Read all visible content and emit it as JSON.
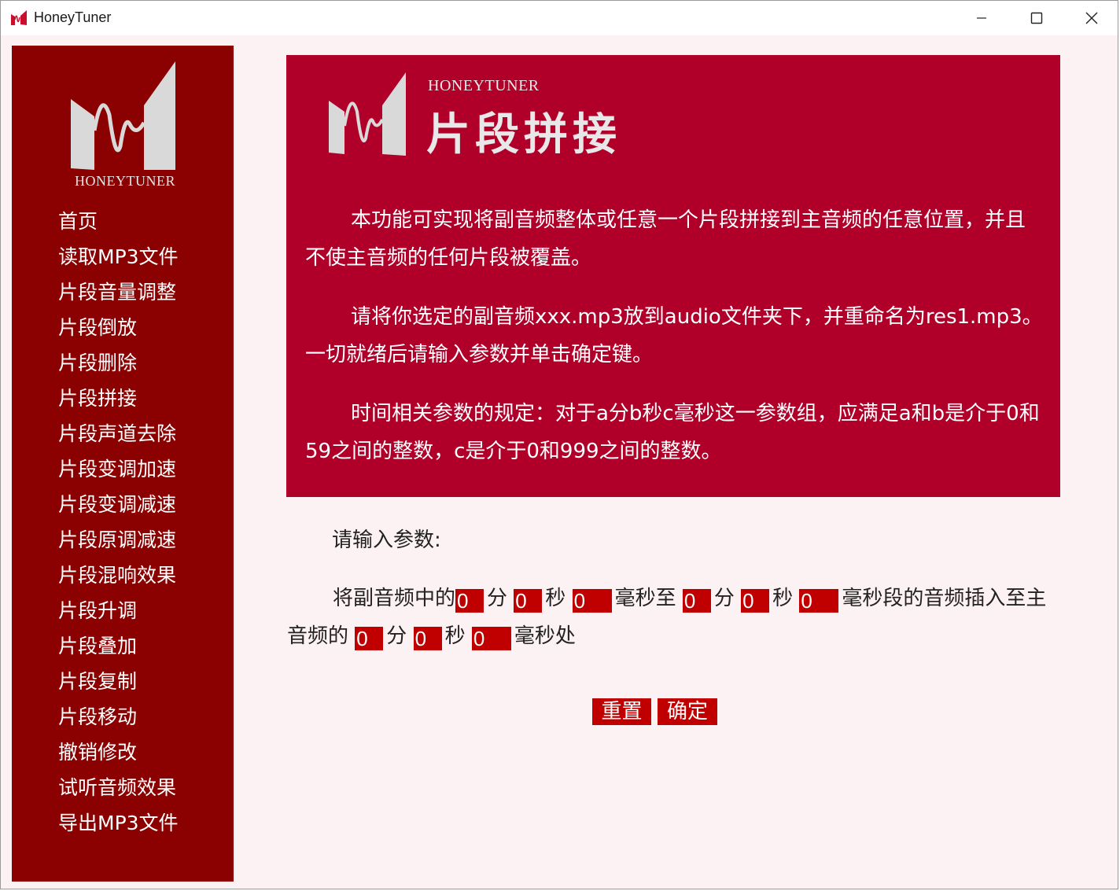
{
  "window": {
    "title": "HoneyTuner",
    "controls": [
      "minimize-icon",
      "maximize-icon",
      "close-icon"
    ]
  },
  "sidebar": {
    "logo_text": "HONEYTUNER",
    "items": [
      {
        "label": "首页"
      },
      {
        "label": "读取MP3文件"
      },
      {
        "label": "片段音量调整"
      },
      {
        "label": "片段倒放"
      },
      {
        "label": "片段删除"
      },
      {
        "label": "片段拼接"
      },
      {
        "label": "片段声道去除"
      },
      {
        "label": "片段变调加速"
      },
      {
        "label": "片段变调减速"
      },
      {
        "label": "片段原调减速"
      },
      {
        "label": "片段混响效果"
      },
      {
        "label": "片段升调"
      },
      {
        "label": "片段叠加"
      },
      {
        "label": "片段复制"
      },
      {
        "label": "片段移动"
      },
      {
        "label": "撤销修改"
      },
      {
        "label": "试听音频效果"
      },
      {
        "label": "导出MP3文件"
      }
    ]
  },
  "banner": {
    "brand": "HONEYTUNER",
    "title": "片段拼接",
    "paragraphs": [
      "本功能可实现将副音频整体或任意一个片段拼接到主音频的任意位置，并且不使主音频的任何片段被覆盖。",
      "请将你选定的副音频xxx.mp3放到audio文件夹下，并重命名为res1.mp3。一切就绪后请输入参数并单击确定键。",
      "时间相关参数的规定：对于a分b秒c毫秒这一参数组，应满足a和b是介于0和59之间的整数，c是介于0和999之间的整数。"
    ]
  },
  "params": {
    "label": "请输入参数:",
    "lead": "将副音频中的",
    "u_min": "分",
    "u_sec": "秒",
    "u_ms_to": "毫秒至",
    "u_ms_seg": "毫秒段的音频插入至主音频的",
    "u_ms_end": "毫秒处",
    "values": {
      "start_min": "0",
      "start_sec": "0",
      "start_ms": "0",
      "end_min": "0",
      "end_sec": "0",
      "end_ms": "0",
      "pos_min": "0",
      "pos_sec": "0",
      "pos_ms": "0"
    }
  },
  "buttons": {
    "reset": "重置",
    "confirm": "确定"
  },
  "colors": {
    "sidebar": "#8b0000",
    "banner": "#b0002a",
    "accent": "#c00000",
    "content_bg": "#fdf2f3"
  }
}
